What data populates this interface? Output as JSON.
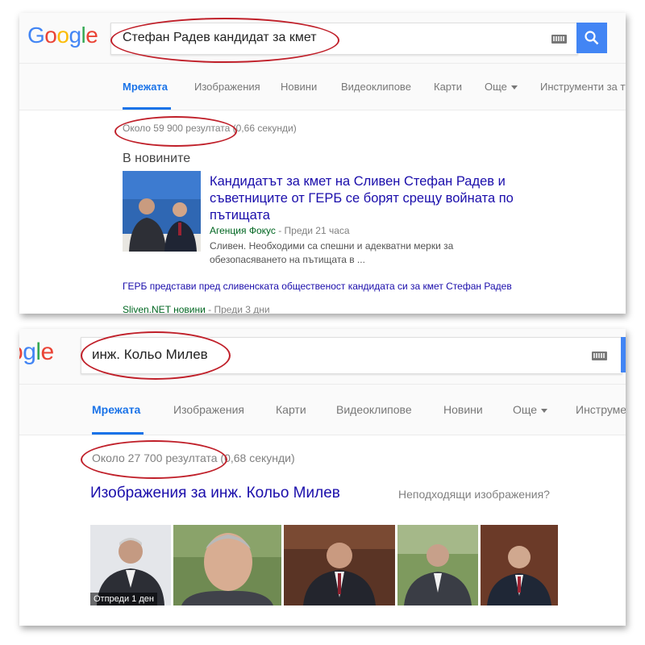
{
  "screenshot1": {
    "logo": {
      "letters": [
        "G",
        "o",
        "o",
        "g",
        "l",
        "e"
      ],
      "colors": [
        "#4285f4",
        "#ea4335",
        "#fbbc05",
        "#4285f4",
        "#34a853",
        "#ea4335"
      ]
    },
    "query": "Стефан Радев кандидат за кмет",
    "tabs": [
      "Мрежата",
      "Изображения",
      "Новини",
      "Видеоклипове",
      "Карти",
      "Още",
      "Инструменти за тъ"
    ],
    "result_stats": "Около 59 900 резултата (0,66 секунди)",
    "section_title": "В новините",
    "news_main": {
      "title": "Кандидатът за кмет на Сливен Стефан Радев и съветниците от ГЕРБ се борят срещу войната по пътищата",
      "source": "Агенция Фокус",
      "time": " - Преди 21 часа",
      "snippet": "Сливен. Необходими са спешни и адекватни мерки за обезопасяването на пътищата в ..."
    },
    "news_second": {
      "title": "ГЕРБ представи пред сливенската общественост кандидата си за кмет Стефан Радев",
      "source": "Sliven.NET новини",
      "time": " - Преди 3 дни"
    }
  },
  "screenshot2": {
    "logo": {
      "letters": [
        "o",
        "g",
        "l",
        "e"
      ],
      "colors": [
        "#ea4335",
        "#4285f4",
        "#34a853",
        "#ea4335"
      ]
    },
    "query": "инж. Кольо Милев",
    "tabs": [
      "Мрежата",
      "Изображения",
      "Карти",
      "Видеоклипове",
      "Новини",
      "Още",
      "Инструме"
    ],
    "result_stats": "Около 27 700 резултата (0,68 секунди)",
    "images_title": "Изображения за инж. Кольо Милев",
    "images_report": "Неподходящи изображения?",
    "first_thumb_badge": "Отпреди 1 ден"
  },
  "colors": {
    "accent": "#4285f4",
    "link": "#1a0dab",
    "source_green": "#006621",
    "highlight_oval": "#c0202a"
  }
}
